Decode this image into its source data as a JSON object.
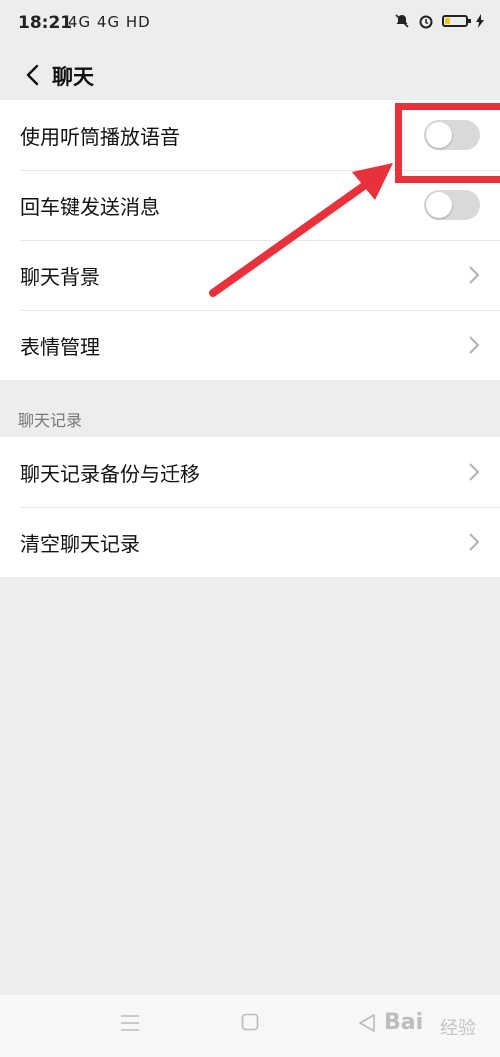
{
  "status_bar": {
    "time": "18:21",
    "signal": "4G 4G HD"
  },
  "header": {
    "title": "聊天"
  },
  "settings": {
    "earpiece_label": "使用听筒播放语音",
    "earpiece_enabled": false,
    "enter_send_label": "回车键发送消息",
    "enter_send_enabled": false,
    "background_label": "聊天背景",
    "stickers_label": "表情管理"
  },
  "chat_history": {
    "section_title": "聊天记录",
    "backup_label": "聊天记录备份与迁移",
    "clear_label": "清空聊天记录"
  },
  "watermark": {
    "brand": "Bai",
    "suffix": "经验"
  },
  "colors": {
    "annotation": "#e8313a",
    "toggle_off": "#d9d9d9",
    "battery": "#f5c400"
  }
}
